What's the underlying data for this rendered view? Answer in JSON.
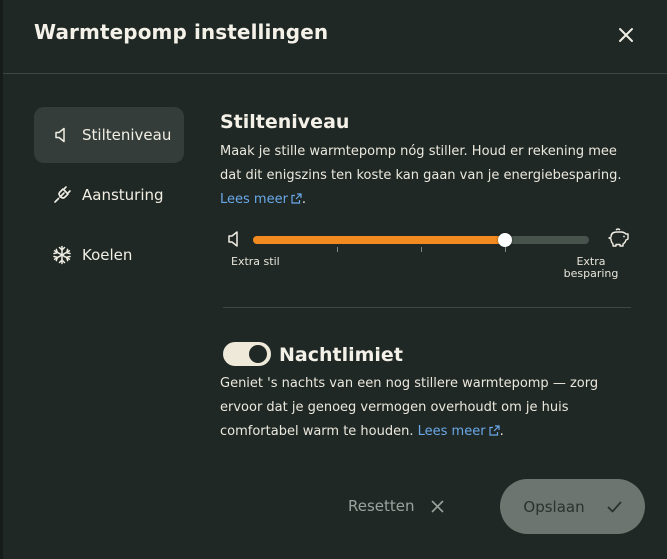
{
  "dialog": {
    "title": "Warmtepomp instellingen"
  },
  "sidebar": {
    "items": [
      {
        "label": "Stilteniveau",
        "icon": "speaker-icon",
        "active": true
      },
      {
        "label": "Aansturing",
        "icon": "plug-icon",
        "active": false
      },
      {
        "label": "Koelen",
        "icon": "snowflake-icon",
        "active": false
      }
    ]
  },
  "silence": {
    "heading": "Stilteniveau",
    "text_line1": "Maak je stille warmtepomp nóg stiller. Houd er rekening mee",
    "text_line2": "dat dit enigszins ten koste kan gaan van je energiebesparing.",
    "link": "Lees meer",
    "link_suffix": ".",
    "slider": {
      "value": 0.75,
      "left_label": "Extra stil",
      "right_label_line1": "Extra",
      "right_label_line2": "besparing"
    }
  },
  "night_limit": {
    "heading": "Nachtlimiet",
    "enabled": true,
    "text_line1": "Geniet 's nachts van een nog stillere warmtepomp — zorg",
    "text_line2": "ervoor dat je genoeg vermogen overhoudt om je huis",
    "text_line3": "comfortabel warm te houden.",
    "link": "Lees meer",
    "link_suffix": "."
  },
  "footer": {
    "reset_label": "Resetten",
    "save_label": "Opslaan"
  },
  "colors": {
    "accent": "#f28a1f",
    "link": "#6aa8e8",
    "background": "#1f2824"
  }
}
